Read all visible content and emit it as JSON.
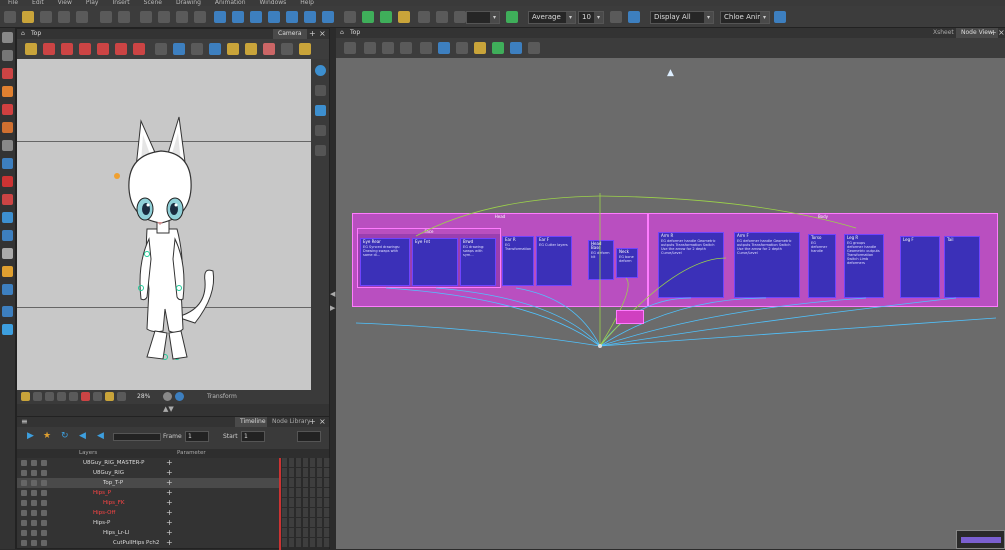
{
  "menubar": [
    "File",
    "Edit",
    "View",
    "Play",
    "Insert",
    "Scene",
    "Drawing",
    "Animation",
    "Windows",
    "Help"
  ],
  "toolbar": {
    "interpolation": "Average",
    "value": "10",
    "display": "Display All",
    "scene": "Chloe Anim"
  },
  "camera_panel": {
    "scene_label": "Top",
    "tab": "Camera",
    "zoom": "28%",
    "mode": "Transform"
  },
  "timeline_panel": {
    "tabs": [
      "Timeline",
      "Node Library"
    ],
    "frame_label": "Frame",
    "frame_value": "1",
    "start_label": "Start",
    "start_value": "1",
    "columns": [
      "Layers",
      "Parameter"
    ],
    "layers": [
      {
        "name": "U8Guy_RIG_MASTER-P",
        "indent": 0,
        "color": "#dddddd"
      },
      {
        "name": "U8Guy_RIG",
        "indent": 1,
        "color": "#dddddd"
      },
      {
        "name": "Top_T-P",
        "indent": 2,
        "color": "#dddddd"
      },
      {
        "name": "Hips_P",
        "indent": 1,
        "color": "#ff4444"
      },
      {
        "name": "Hips_FK",
        "indent": 2,
        "color": "#ff4444"
      },
      {
        "name": "Hips-Off",
        "indent": 1,
        "color": "#ff4444"
      },
      {
        "name": "Hips-P",
        "indent": 1,
        "color": "#dddddd"
      },
      {
        "name": "Hips_Lr-Ll",
        "indent": 2,
        "color": "#dddddd"
      },
      {
        "name": "CutPullHips Pch2",
        "indent": 3,
        "color": "#dddddd"
      }
    ]
  },
  "nodeview_panel": {
    "scene_label": "Top",
    "tabs": [
      "Xsheet",
      "Node View"
    ],
    "groups": [
      {
        "name": "Head"
      },
      {
        "name": "Body"
      },
      {
        "name": "Face"
      }
    ],
    "nodes": [
      {
        "title": "Eye Rear",
        "note": "EG Synced drawings: Drawing swaps with same di..."
      },
      {
        "title": "Eye Fnt",
        "note": ""
      },
      {
        "title": "Brwd",
        "note": "EG drawing: swaps with sym..."
      },
      {
        "title": "Ear R",
        "note": "EG Transformation"
      },
      {
        "title": "Ear F",
        "note": "EG Cutter layers"
      },
      {
        "title": "Head Base",
        "note": "EG deform kit"
      },
      {
        "title": "Neck",
        "note": "EG bone deform"
      },
      {
        "title": "Arm R",
        "note": "EG deformer handle Geometric outputs Transformation Switch Use the arrow for 2 depth Curve/Level"
      },
      {
        "title": "Arm F",
        "note": "EG deformer handle Geometric outputs Transformation Switch Use the arrow for 2 depth Curve/Level"
      },
      {
        "title": "Torso",
        "note": "EG deformer handle"
      },
      {
        "title": "Leg R",
        "note": "EG groups deformer handle Geometric outputs Transformation Switch Limb deformers"
      },
      {
        "title": "Leg F",
        "note": ""
      },
      {
        "title": "Tail",
        "note": ""
      }
    ]
  },
  "colors": {
    "group_magenta": "#b94fc0",
    "node_blue": "#3b30b8",
    "graph_bg": "#6b6b6b",
    "wire_cyan": "#4fc3ff",
    "wire_green": "#9cd34a"
  }
}
